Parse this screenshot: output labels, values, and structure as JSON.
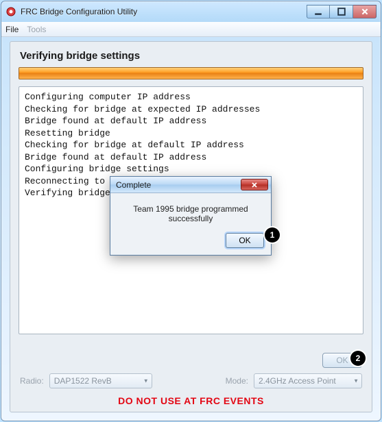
{
  "window": {
    "title": "FRC Bridge Configuration Utility"
  },
  "menu": {
    "file": "File",
    "tools": "Tools"
  },
  "heading": "Verifying bridge settings",
  "log_lines": "Configuring computer IP address\nChecking for bridge at expected IP addresses\nBridge found at default IP address\nResetting bridge\nChecking for bridge at default IP address\nBridge found at default IP address\nConfiguring bridge settings\nReconnecting to b\nVerifying bridge",
  "main_ok": "OK",
  "dialog": {
    "title": "Complete",
    "message": "Team 1995 bridge programmed successfully",
    "ok": "OK"
  },
  "bottom": {
    "radio_label": "Radio:",
    "radio_value": "DAP1522 RevB",
    "mode_label": "Mode:",
    "mode_value": "2.4GHz Access Point"
  },
  "warning": "DO NOT USE AT FRC EVENTS",
  "annotations": {
    "a1": "1",
    "a2": "2"
  }
}
